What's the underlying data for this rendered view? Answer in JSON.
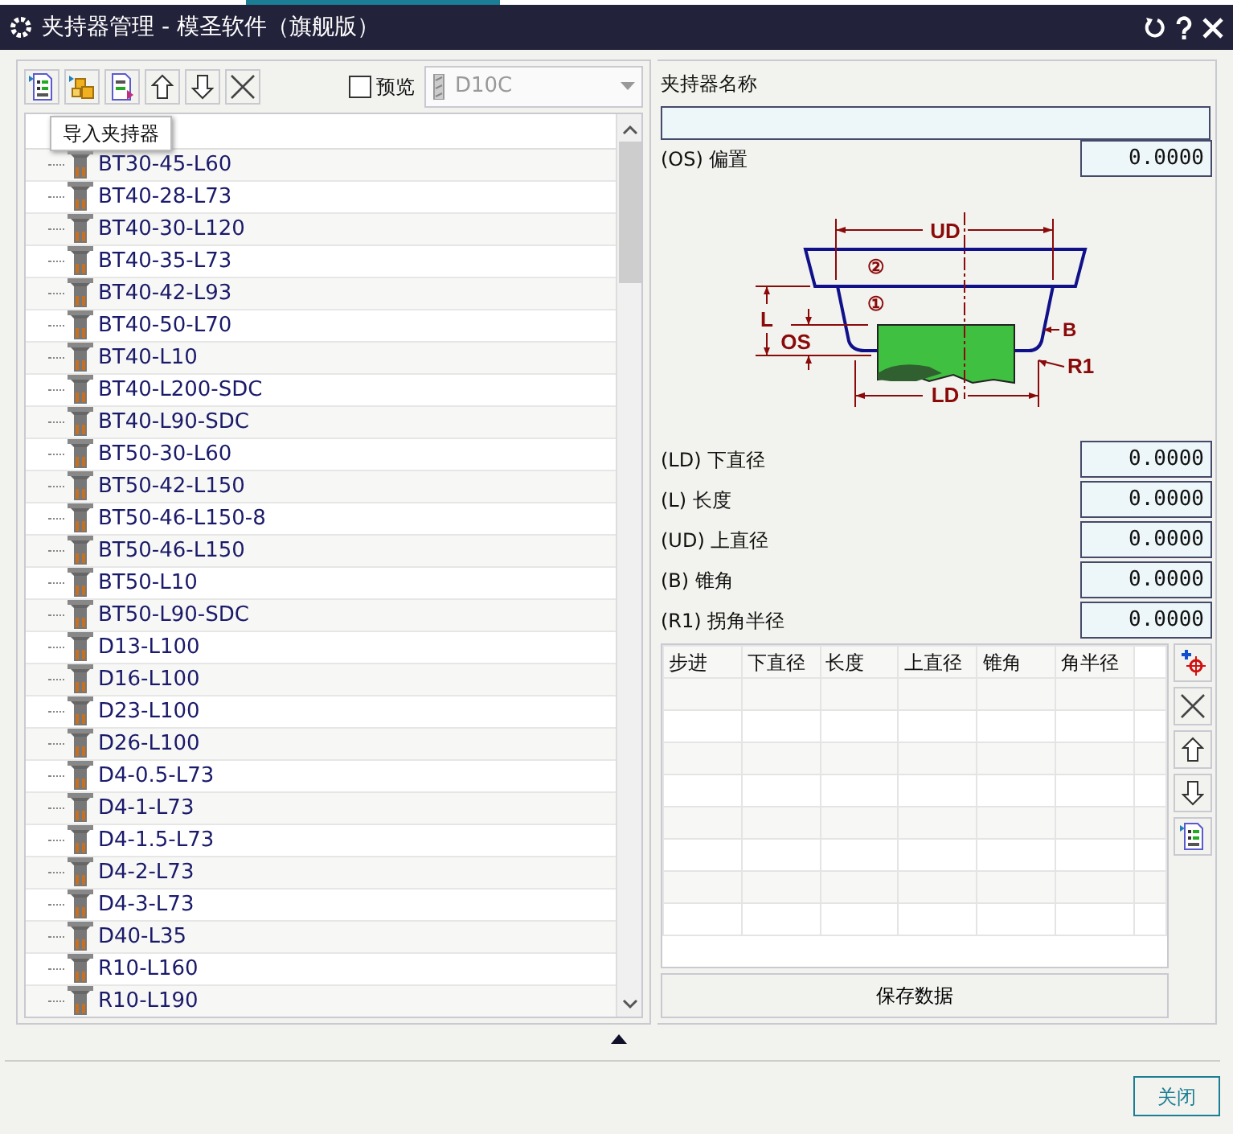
{
  "window": {
    "title": "夹持器管理 - 模圣软件（旗舰版）"
  },
  "toolbar": {
    "preview": {
      "label": "预览",
      "checked": false
    },
    "holder_select": {
      "value": "D10C",
      "disabled": true
    }
  },
  "tooltip": "导入夹持器",
  "tree": {
    "items": [
      {
        "label": "BT30-45-L60"
      },
      {
        "label": "BT40-28-L73"
      },
      {
        "label": "BT40-30-L120"
      },
      {
        "label": "BT40-35-L73"
      },
      {
        "label": "BT40-42-L93"
      },
      {
        "label": "BT40-50-L70"
      },
      {
        "label": "BT40-L10"
      },
      {
        "label": "BT40-L200-SDC"
      },
      {
        "label": "BT40-L90-SDC"
      },
      {
        "label": "BT50-30-L60"
      },
      {
        "label": "BT50-42-L150"
      },
      {
        "label": "BT50-46-L150-8"
      },
      {
        "label": "BT50-46-L150"
      },
      {
        "label": "BT50-L10"
      },
      {
        "label": "BT50-L90-SDC"
      },
      {
        "label": "D13-L100"
      },
      {
        "label": "D16-L100"
      },
      {
        "label": "D23-L100"
      },
      {
        "label": "D26-L100"
      },
      {
        "label": "D4-0.5-L73"
      },
      {
        "label": "D4-1-L73"
      },
      {
        "label": "D4-1.5-L73"
      },
      {
        "label": "D4-2-L73"
      },
      {
        "label": "D4-3-L73"
      },
      {
        "label": "D40-L35"
      },
      {
        "label": "R10-L160"
      },
      {
        "label": "R10-L190"
      }
    ]
  },
  "name_field": {
    "label": "夹持器名称"
  },
  "offset": {
    "label": "(OS) 偏置",
    "value": "0.0000"
  },
  "diagram": {
    "labels": [
      "UD",
      "②",
      "①",
      "L",
      "OS",
      "B",
      "R1",
      "LD"
    ]
  },
  "params": [
    {
      "label": "(LD) 下直径",
      "value": "0.0000"
    },
    {
      "label": "(L) 长度",
      "value": "0.0000"
    },
    {
      "label": "(UD) 上直径",
      "value": "0.0000"
    },
    {
      "label": "(B) 锥角",
      "value": "0.0000"
    },
    {
      "label": "(R1) 拐角半径",
      "value": "0.0000"
    }
  ],
  "steps_table": {
    "columns": [
      "步进",
      "下直径",
      "长度",
      "上直径",
      "锥角",
      "角半径"
    ]
  },
  "save_button": "保存数据",
  "close_button": "关闭"
}
